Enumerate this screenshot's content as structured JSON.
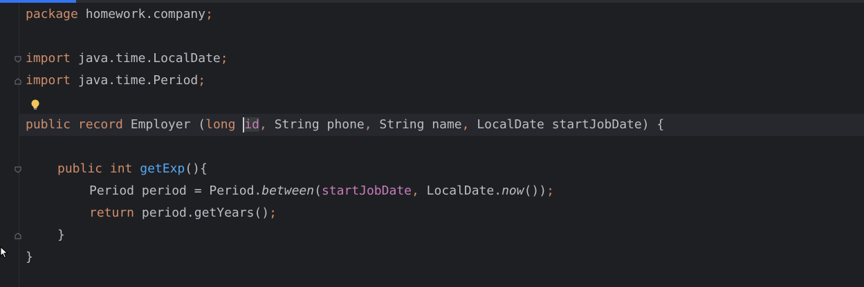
{
  "code": {
    "line1": {
      "kw": "package",
      "rest": " homework.company",
      "semi": ";"
    },
    "line3": {
      "kw": "import",
      "rest": " java.time.LocalDate",
      "semi": ";"
    },
    "line4": {
      "kw": "import",
      "rest": " java.time.Period",
      "semi": ";"
    },
    "line6": {
      "public": "public",
      "record": "record",
      "name": " Employer (",
      "long": "long",
      "sp": " ",
      "id_first": "i",
      "id_rest": "d",
      "c1": ",",
      "p2": " String phone",
      "c2": ",",
      "p3": " String name",
      "c3": ",",
      "p4": " LocalDate startJobDate) {"
    },
    "line8": {
      "public": "public",
      "int": "int",
      "method": "getExp",
      "rest": "(){"
    },
    "line9": {
      "a": "Period period = Period.",
      "between": "between",
      "open": "(",
      "param": "startJobDate",
      "comma": ",",
      "b": " LocalDate.",
      "now": "now",
      "c": "())",
      "semi": ";"
    },
    "line10": {
      "kw": "return",
      "rest": " period.getYears()",
      "semi": ";"
    },
    "line11": {
      "brace": "}"
    },
    "line12": {
      "brace": "}"
    }
  },
  "icons": {
    "bulb": "lightbulb-icon",
    "fold": "fold-marker-icon",
    "cursor": "mouse-pointer-icon"
  },
  "colors": {
    "background": "#1e1f22",
    "keyword": "#cf8e6d",
    "method": "#56a8f5",
    "parameter": "#c77dbb",
    "text": "#bcbec4",
    "accent": "#3574f0"
  }
}
